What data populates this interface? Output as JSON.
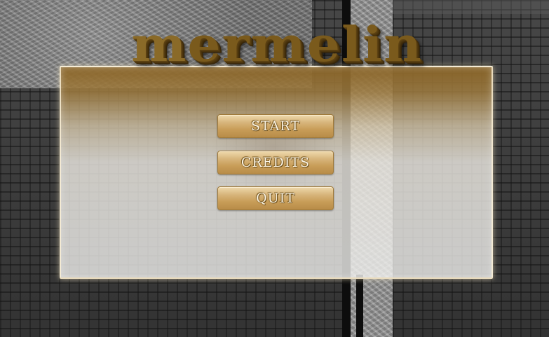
{
  "game": {
    "title": "mermelin"
  },
  "menu": {
    "start_label": "START",
    "credits_label": "CREDITS",
    "quit_label": "QUIT"
  },
  "colors": {
    "panel_top": "#8a6426",
    "panel_body": "#ebe8e1",
    "button_gold": "#d7b47a",
    "title_bronze": "#7a5a1c",
    "wall": "#3c3c3c"
  }
}
